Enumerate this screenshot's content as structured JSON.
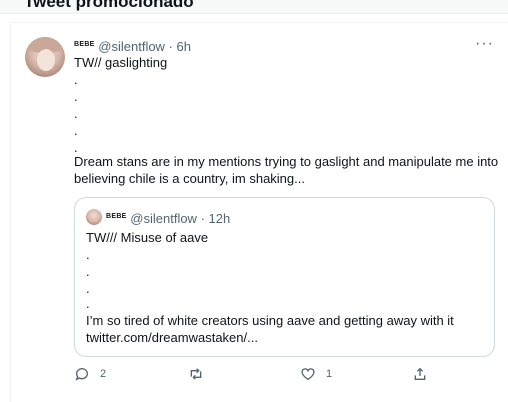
{
  "section": {
    "title": "Tweet promocionado"
  },
  "tweet": {
    "author_name": "BEBE",
    "handle": "@silentflow",
    "time": "· 6h",
    "more": "···",
    "lines": [
      "TW// gaslighting",
      ".",
      ".",
      ".",
      ".",
      ".",
      "Dream stans are in my mentions trying to gaslight and manipulate me into",
      "believing chile is a country, im shaking..."
    ],
    "quote": {
      "author_name": "BEBE",
      "handle": "@silentflow",
      "time": "· 12h",
      "lines": [
        "TW/// Misuse of aave",
        ".",
        ".",
        ".",
        ".",
        "I’m so tired of white creators using aave and getting away with it",
        "twitter.com/dreamwastaken/..."
      ]
    },
    "actions": {
      "reply_count": "2",
      "retweet_count": "",
      "like_count": "1",
      "icons": [
        "reply-icon",
        "retweet-icon",
        "like-icon",
        "share-icon"
      ]
    }
  }
}
